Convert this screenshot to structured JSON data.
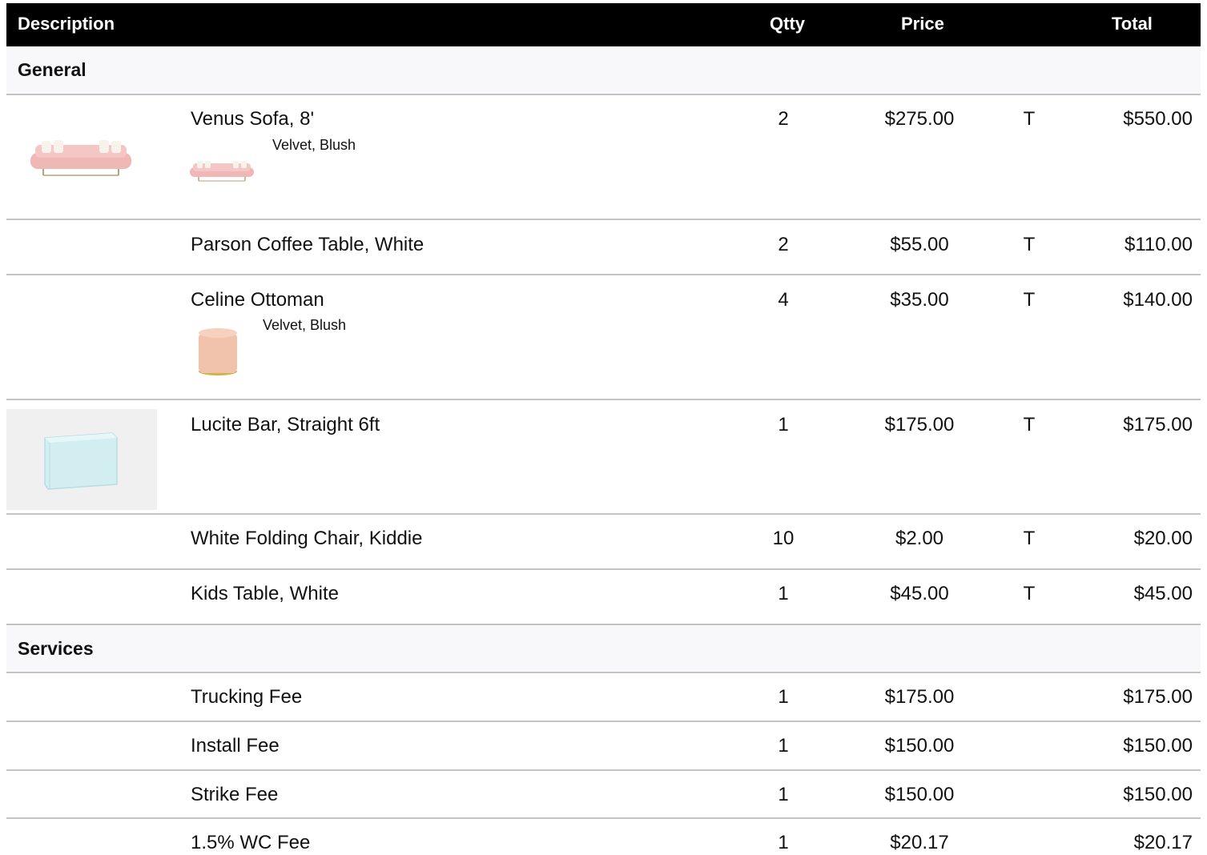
{
  "header": {
    "description": "Description",
    "qty": "Qtty",
    "price": "Price",
    "total": "Total"
  },
  "sections": [
    {
      "title": "General",
      "items": [
        {
          "description": "Venus Sofa, 8'",
          "detail": "Velvet, Blush",
          "qty": "2",
          "price": "$275.00",
          "tax": "T",
          "total": "$550.00",
          "image": "pink-velvet-sofa"
        },
        {
          "description": "Parson Coffee Table, White",
          "qty": "2",
          "price": "$55.00",
          "tax": "T",
          "total": "$110.00"
        },
        {
          "description": "Celine Ottoman",
          "detail": "Velvet, Blush",
          "qty": "4",
          "price": "$35.00",
          "tax": "T",
          "total": "$140.00",
          "image": "blush-ottoman"
        },
        {
          "description": "Lucite Bar, Straight 6ft",
          "qty": "1",
          "price": "$175.00",
          "tax": "T",
          "total": "$175.00",
          "image": "lucite-bar"
        },
        {
          "description": "White Folding Chair, Kiddie",
          "qty": "10",
          "price": "$2.00",
          "tax": "T",
          "total": "$20.00"
        },
        {
          "description": "Kids Table, White",
          "qty": "1",
          "price": "$45.00",
          "tax": "T",
          "total": "$45.00"
        }
      ]
    },
    {
      "title": "Services",
      "items": [
        {
          "description": "Trucking Fee",
          "qty": "1",
          "price": "$175.00",
          "tax": "",
          "total": "$175.00"
        },
        {
          "description": "Install Fee",
          "qty": "1",
          "price": "$150.00",
          "tax": "",
          "total": "$150.00"
        },
        {
          "description": "Strike Fee",
          "qty": "1",
          "price": "$150.00",
          "tax": "",
          "total": "$150.00"
        },
        {
          "description": "1.5% WC Fee",
          "qty": "1",
          "price": "$20.17",
          "tax": "",
          "total": "$20.17"
        }
      ]
    }
  ],
  "colors": {
    "header_bg": "#000000",
    "section_bg": "#f8f8fa",
    "separator": "#c4c4c4",
    "sofa": "#f0b7b7",
    "ottoman": "#f1c3ad",
    "lucite": "#d3eef0"
  }
}
